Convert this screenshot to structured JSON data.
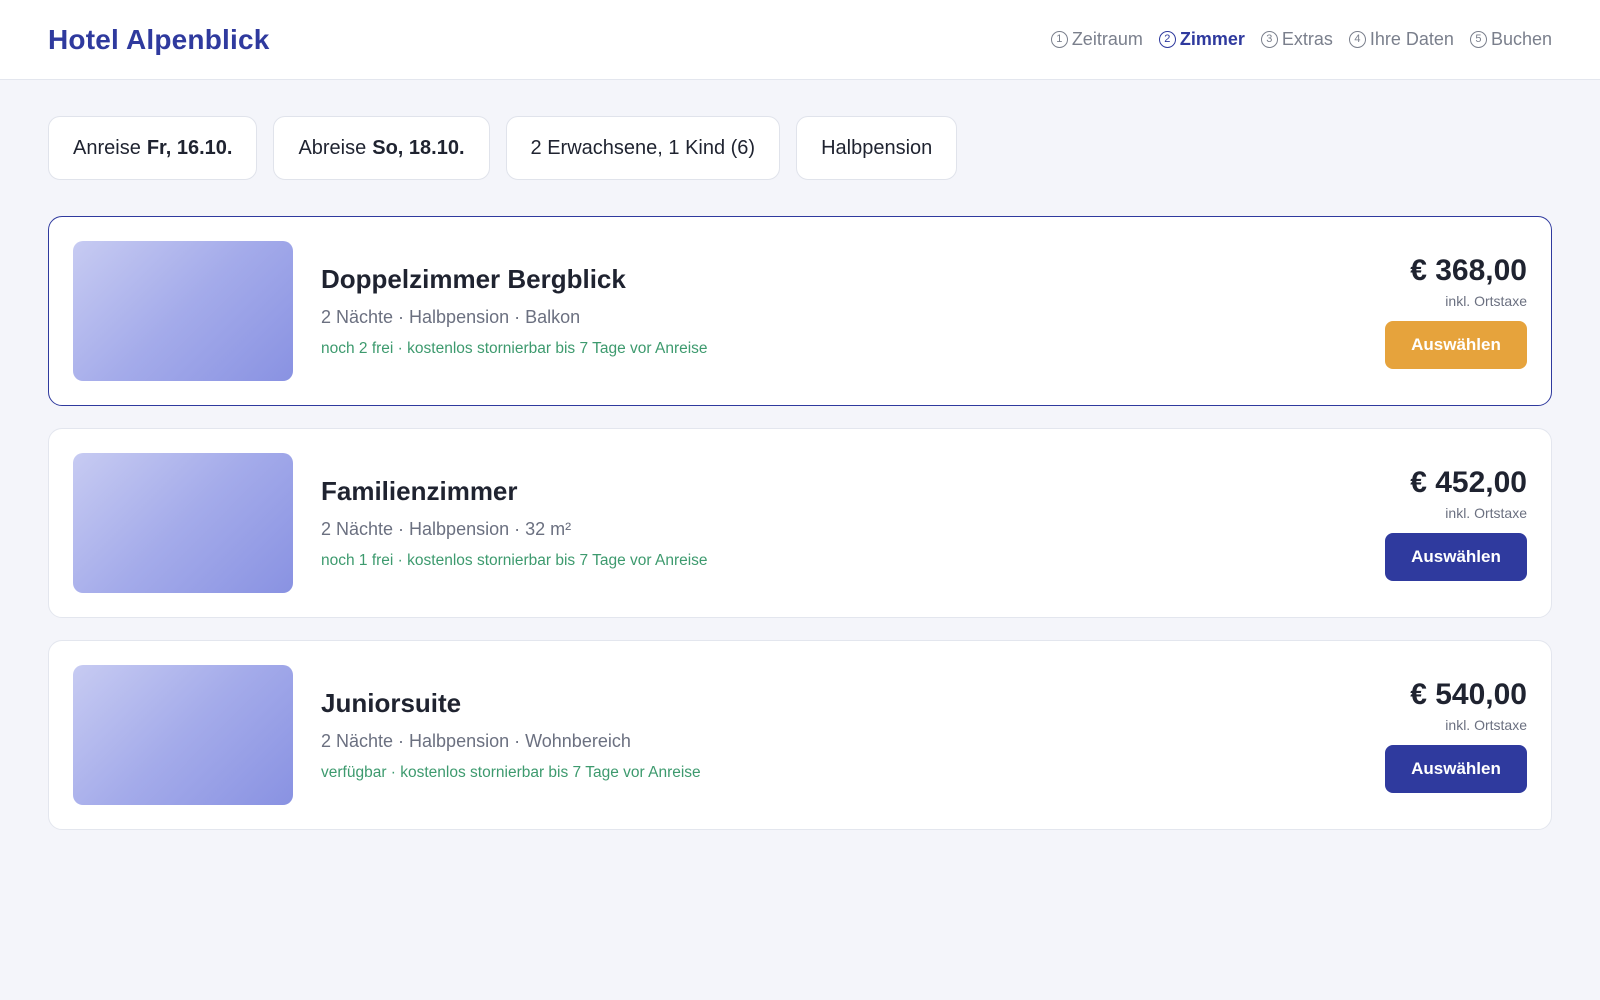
{
  "header": {
    "brand": "Hotel Alpenblick",
    "steps": [
      {
        "num": "1",
        "label": "Zeitraum"
      },
      {
        "num": "2",
        "label": "Zimmer"
      },
      {
        "num": "3",
        "label": "Extras"
      },
      {
        "num": "4",
        "label": "Ihre Daten"
      },
      {
        "num": "5",
        "label": "Buchen"
      }
    ],
    "active_step": "Zimmer"
  },
  "filters": {
    "arrival_label": "Anreise",
    "arrival_value": "Fr, 16.10.",
    "departure_label": "Abreise",
    "departure_value": "So, 18.10.",
    "guests": "2 Erwachsene, 1 Kind (6)",
    "board": "Halbpension"
  },
  "rooms": [
    {
      "title": "Doppelzimmer Bergblick",
      "meta": "2 Nächte · Halbpension · Balkon",
      "availability": "noch 2 frei · kostenlos stornierbar bis 7 Tage vor Anreise",
      "price": "€ 368,00",
      "tax_note": "inkl. Ortstaxe",
      "button": "Auswählen",
      "selected": true
    },
    {
      "title": "Familienzimmer",
      "meta": "2 Nächte · Halbpension · 32 m²",
      "availability": "noch 1 frei · kostenlos stornierbar bis 7 Tage vor Anreise",
      "price": "€ 452,00",
      "tax_note": "inkl. Ortstaxe",
      "button": "Auswählen",
      "selected": false
    },
    {
      "title": "Juniorsuite",
      "meta": "2 Nächte · Halbpension · Wohnbereich",
      "availability": "verfügbar · kostenlos stornierbar bis 7 Tage vor Anreise",
      "price": "€ 540,00",
      "tax_note": "inkl. Ortstaxe",
      "button": "Auswählen",
      "selected": false
    }
  ],
  "colors": {
    "brand": "#2f3a9e",
    "accent_button": "#e6a33c",
    "availability_text": "#3d9a6e",
    "background": "#f4f5fa"
  }
}
